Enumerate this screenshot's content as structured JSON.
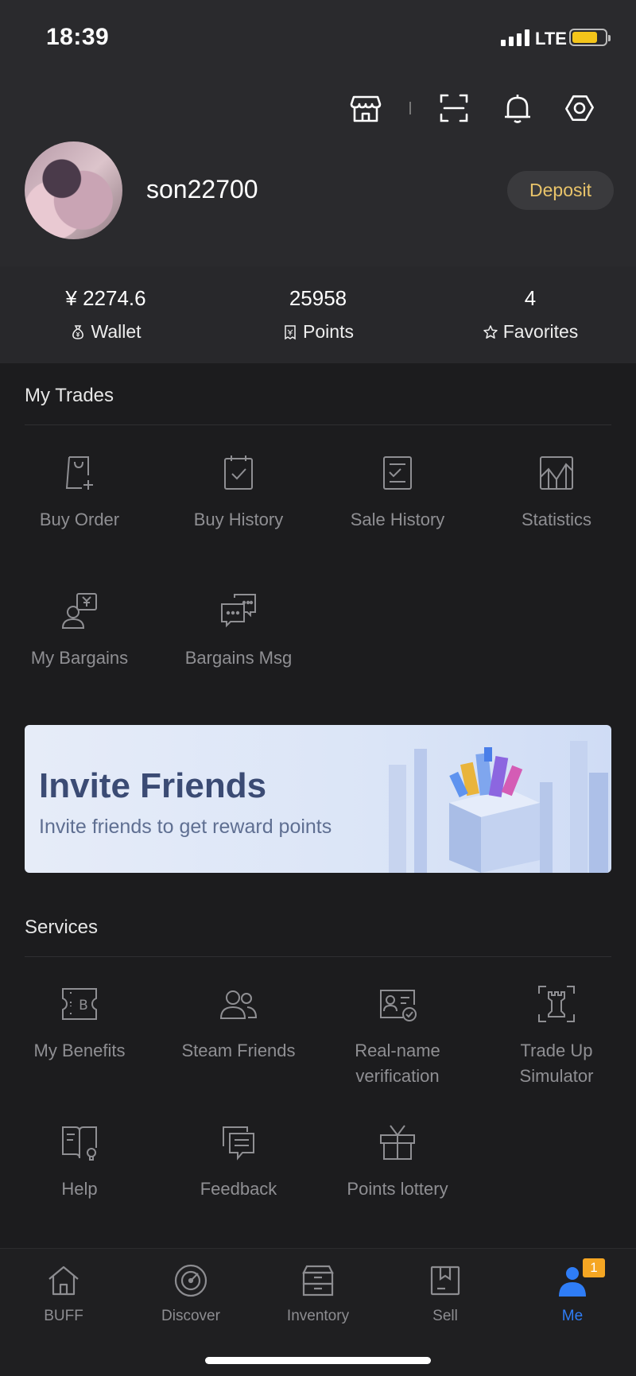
{
  "status_bar": {
    "time": "18:39",
    "network": "LTE"
  },
  "profile": {
    "username": "son22700",
    "deposit_label": "Deposit"
  },
  "stats": [
    {
      "value": "¥ 2274.6",
      "label": "Wallet",
      "icon": "money-bag-icon"
    },
    {
      "value": "25958",
      "label": "Points",
      "icon": "ticket-icon"
    },
    {
      "value": "4",
      "label": "Favorites",
      "icon": "star-icon"
    }
  ],
  "trades": {
    "title": "My Trades",
    "items": [
      {
        "label": "Buy Order",
        "icon": "shopping-bag-plus-icon"
      },
      {
        "label": "Buy History",
        "icon": "calendar-check-icon"
      },
      {
        "label": "Sale History",
        "icon": "list-check-icon"
      },
      {
        "label": "Statistics",
        "icon": "chart-icon"
      },
      {
        "label": "My Bargains",
        "icon": "user-yen-icon"
      },
      {
        "label": "Bargains Msg",
        "icon": "chat-bubbles-icon"
      }
    ]
  },
  "banner": {
    "title": "Invite Friends",
    "subtitle": "Invite friends to get reward points"
  },
  "services": {
    "title": "Services",
    "items": [
      {
        "label": "My Benefits",
        "icon": "benefit-ticket-icon"
      },
      {
        "label": "Steam Friends",
        "icon": "friends-icon"
      },
      {
        "label": "Real-name\nverification",
        "icon": "id-card-check-icon"
      },
      {
        "label": "Trade Up\nSimulator",
        "icon": "rook-scan-icon"
      },
      {
        "label": "Help",
        "icon": "book-bulb-icon"
      },
      {
        "label": "Feedback",
        "icon": "feedback-icon"
      },
      {
        "label": "Points lottery",
        "icon": "gift-icon"
      }
    ]
  },
  "tabbar": {
    "tabs": [
      {
        "label": "BUFF",
        "icon": "home-icon"
      },
      {
        "label": "Discover",
        "icon": "compass-icon"
      },
      {
        "label": "Inventory",
        "icon": "inventory-box-icon"
      },
      {
        "label": "Sell",
        "icon": "sell-box-icon"
      },
      {
        "label": "Me",
        "icon": "person-icon"
      }
    ],
    "me_badge": "1",
    "active_color": "#2f7df6"
  },
  "colors": {
    "deposit_text": "#e9c46a",
    "battery": "#f4c51a",
    "badge": "#f5a623"
  }
}
